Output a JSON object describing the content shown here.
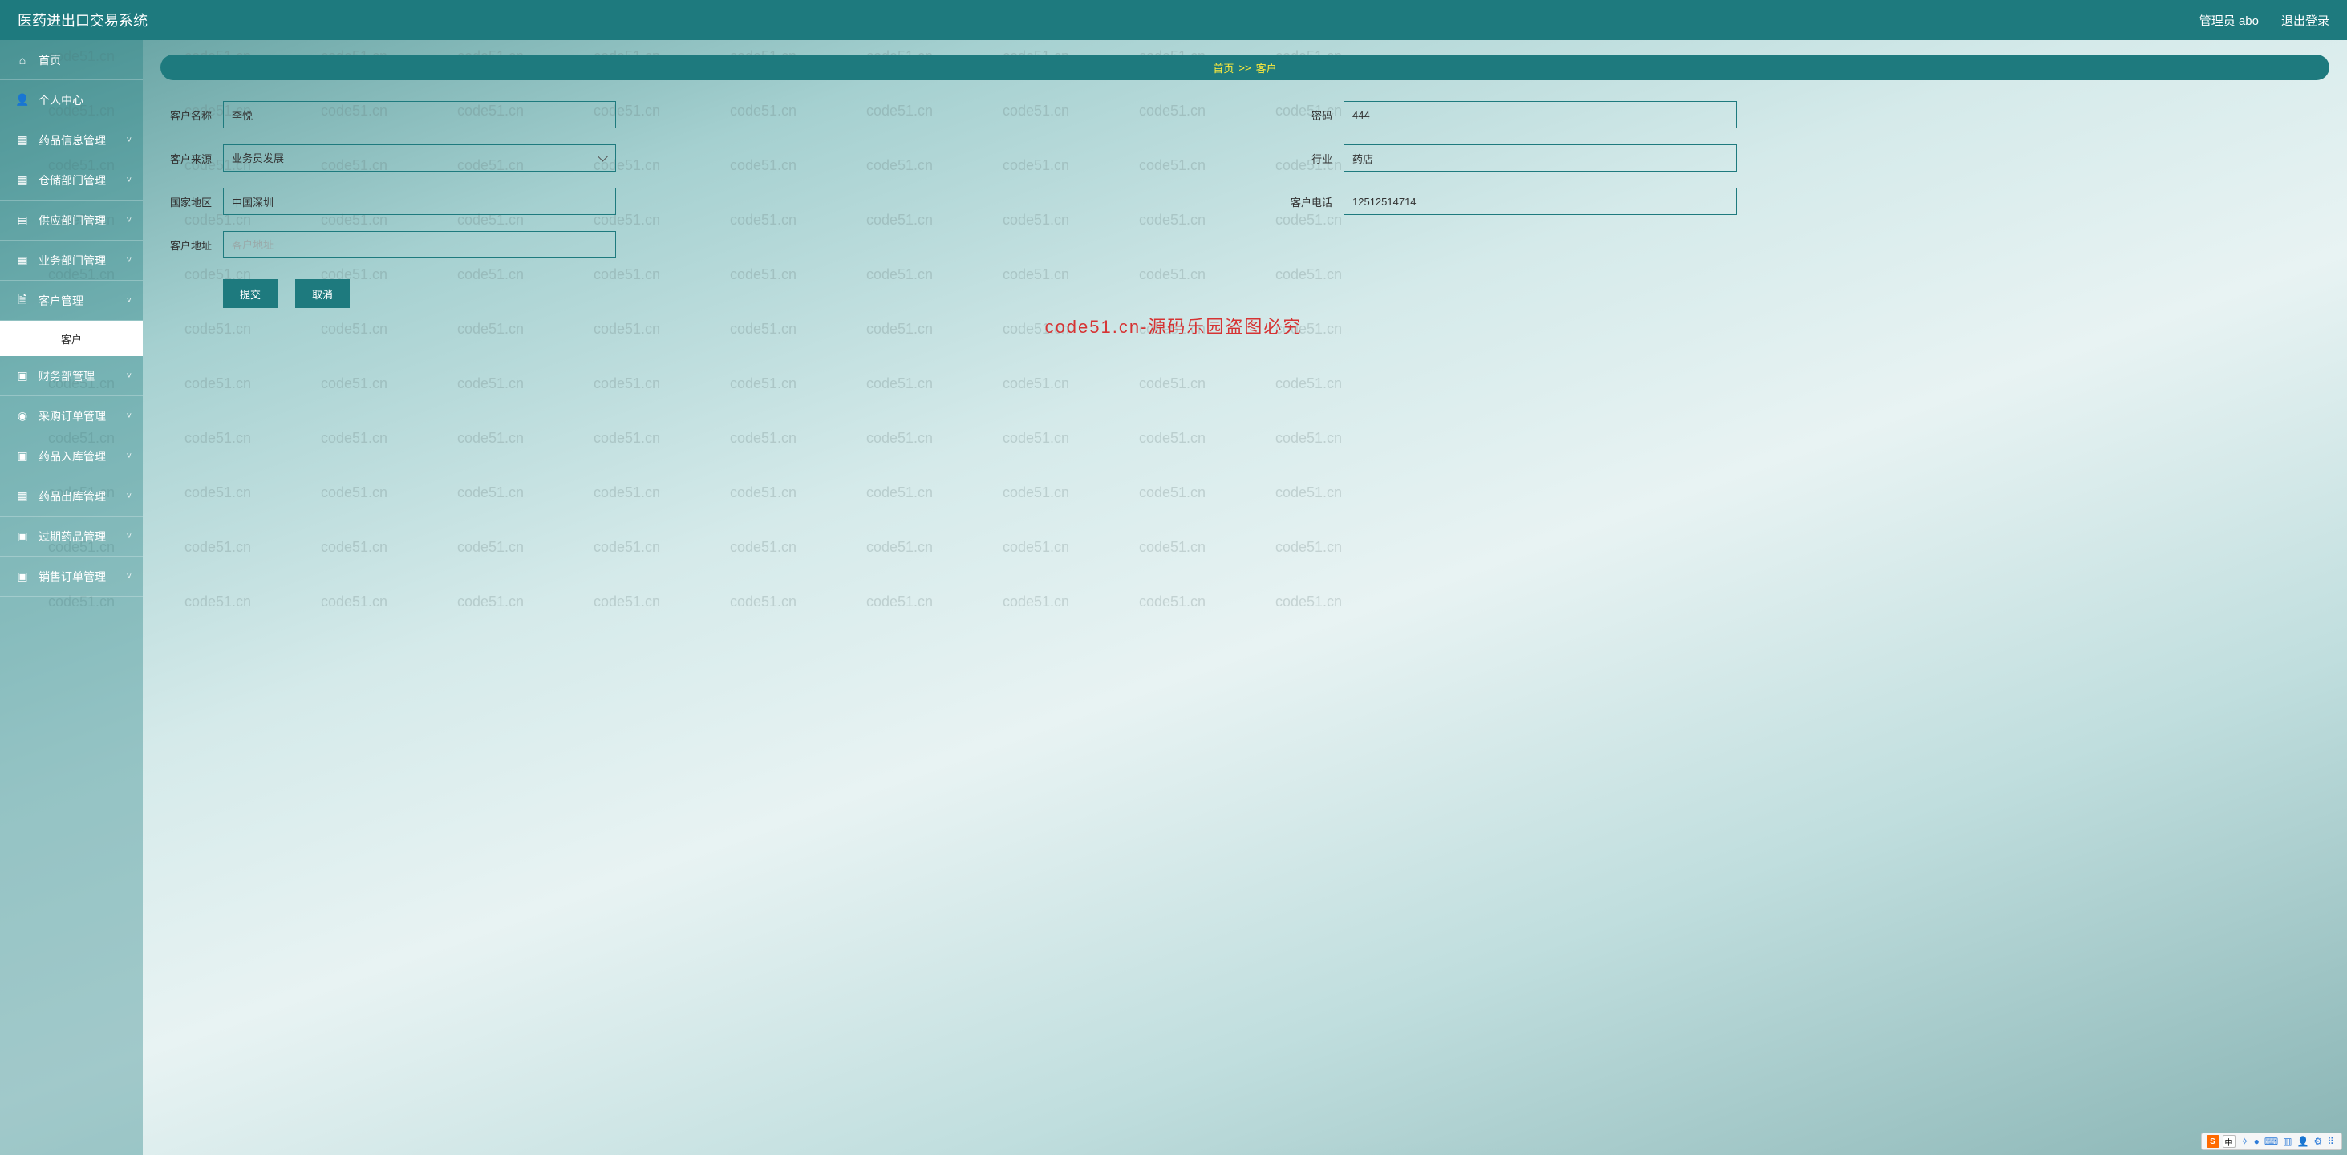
{
  "watermark_text": "code51.cn",
  "topbar": {
    "title": "医药进出口交易系统",
    "user_label": "管理员 abo",
    "logout_label": "退出登录"
  },
  "sidebar": {
    "items": [
      {
        "icon": "⌂",
        "label": "首页",
        "expandable": false
      },
      {
        "icon": "👤",
        "label": "个人中心",
        "expandable": false
      },
      {
        "icon": "▦",
        "label": "药品信息管理",
        "expandable": true
      },
      {
        "icon": "▦",
        "label": "仓储部门管理",
        "expandable": true
      },
      {
        "icon": "▤",
        "label": "供应部门管理",
        "expandable": true
      },
      {
        "icon": "▦",
        "label": "业务部门管理",
        "expandable": true
      },
      {
        "icon": "🗎",
        "label": "客户管理",
        "expandable": true,
        "open": true,
        "sub": "客户"
      },
      {
        "icon": "▣",
        "label": "财务部管理",
        "expandable": true
      },
      {
        "icon": "◉",
        "label": "采购订单管理",
        "expandable": true
      },
      {
        "icon": "▣",
        "label": "药品入库管理",
        "expandable": true
      },
      {
        "icon": "▦",
        "label": "药品出库管理",
        "expandable": true
      },
      {
        "icon": "▣",
        "label": "过期药品管理",
        "expandable": true
      },
      {
        "icon": "▣",
        "label": "销售订单管理",
        "expandable": true
      }
    ]
  },
  "breadcrumb": {
    "home": "首页",
    "sep": ">>",
    "current": "客户"
  },
  "form": {
    "name_label": "客户名称",
    "name_value": "李悦",
    "password_label": "密码",
    "password_value": "444",
    "source_label": "客户来源",
    "source_value": "业务员发展",
    "industry_label": "行业",
    "industry_value": "药店",
    "region_label": "国家地区",
    "region_value": "中国深圳",
    "phone_label": "客户电话",
    "phone_value": "12512514714",
    "address_label": "客户地址",
    "address_value": "",
    "address_placeholder": "客户地址",
    "submit_label": "提交",
    "cancel_label": "取消"
  },
  "overlay_text": "code51.cn-源码乐园盗图必究",
  "ime": {
    "s": "S",
    "zh": "中",
    "items": [
      "✧",
      "●",
      "⌨",
      "▥",
      "👤",
      "⚙",
      "⠿"
    ]
  }
}
